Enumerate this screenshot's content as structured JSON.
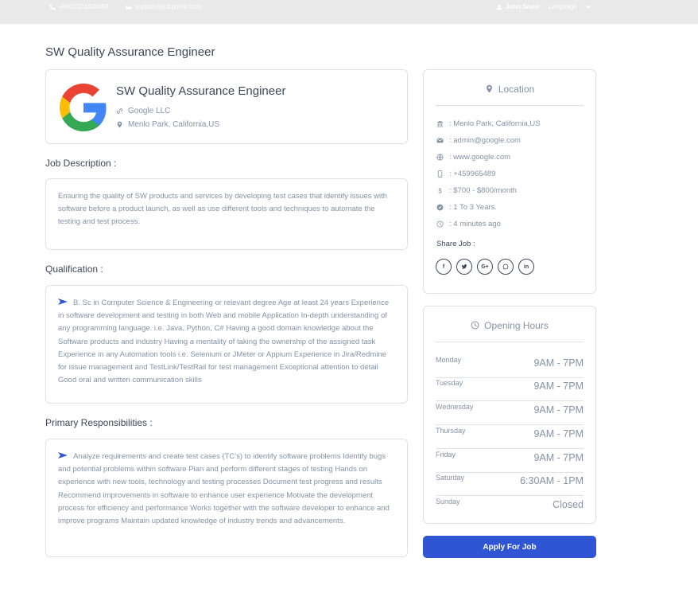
{
  "topbar": {
    "phone": "+8801521426893",
    "email": "support@jobportal.com",
    "user": "John Snow",
    "language": "Language"
  },
  "page_title": "SW Quality Assurance Engineer",
  "job": {
    "title": "SW Quality Assurance Engineer",
    "company": "Google LLC",
    "location": "Menlo Park, California,US"
  },
  "sections": {
    "description_title": "Job Description :",
    "description_text": "Ensuring the quality of SW products and services by developing test cases that identify issues with software before a product launch, as well as use different tools and techniques to automate the testing and test process.",
    "qualification_title": "Qualification :",
    "qualification_text": "B. Sc in Computer Science & Engineering or relevant degree Age at least 24 years Experience in software development and testing in both Web and mobile Application In-depth understanding of any programming language. i.e. Java, Python, C# Having a good domain knowledge about the Software products and industry Having a mentality of taking the ownership of the assigned task Experience in any Automation tools i.e. Selenium or JMeter or Appium Experience in Jira/Redmine for issue management and TestLink/TestRail for test management Exceptional attention to detail Good oral and written communication skills",
    "responsibilities_title": "Primary Responsibilities :",
    "responsibilities_text": "Analyze requirements and create test cases (TC's) to identify software problems Identify bugs and potential problems within software Plan and perform different stages of testing Hands on experience with new tools, technology and testing processes Document test progress and results Recommend improvements in software to enhance user experience Motivate the development process for efficiency and performance Works together with the software developer to enhance and improve programs Maintain updated knowledge of industry trends and advancements."
  },
  "location_card": {
    "title": "Location",
    "address": ": Menlo Park, California,US",
    "email": ": admin@google.com",
    "website": ": www.google.com",
    "phone": ": +459965489",
    "salary": ": $700 - $800/month",
    "experience": ": 1 To 3 Years.",
    "posted": ": 4 minutes ago",
    "share_label": "Share Job :",
    "socials": [
      "facebook-icon",
      "twitter-icon",
      "google-plus-icon",
      "whatsapp-icon",
      "linkedin-icon"
    ]
  },
  "hours_card": {
    "title": "Opening Hours",
    "rows": [
      {
        "day": "Monday",
        "time": "9AM - 7PM"
      },
      {
        "day": "Tuesday",
        "time": "9AM - 7PM"
      },
      {
        "day": "Wednesday",
        "time": "9AM - 7PM"
      },
      {
        "day": "Thursday",
        "time": "9AM - 7PM"
      },
      {
        "day": "Friday",
        "time": "9AM - 7PM"
      },
      {
        "day": "Saturday",
        "time": "6:30AM - 1PM"
      },
      {
        "day": "Sunday",
        "time": "Closed"
      }
    ]
  },
  "apply_label": "Apply For Job",
  "colors": {
    "accent": "#2f55d4",
    "muted_text": "#8492a6",
    "heading_text": "#3c4858"
  }
}
